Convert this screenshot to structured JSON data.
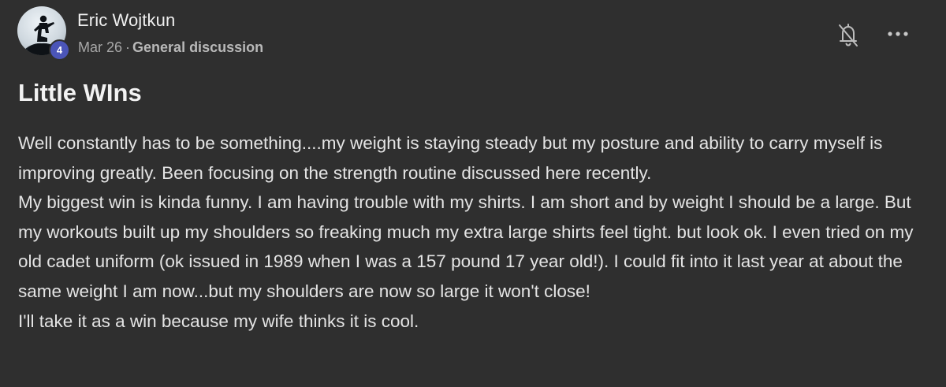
{
  "post": {
    "author": "Eric Wojtkun",
    "badge_count": "4",
    "date": "Mar 26",
    "separator": "·",
    "category": "General discussion",
    "title": "Little WIns",
    "paragraphs": [
      "Well constantly has to be something....my weight is staying steady but my posture and ability to carry myself is improving greatly. Been focusing on the strength routine discussed here recently.",
      "My biggest win is kinda funny. I am having trouble with my shirts. I am short and by weight I should be a large. But my workouts built up my shoulders so freaking much my extra large shirts feel tight. but look ok. I even tried on my old cadet uniform (ok issued in 1989 when I was a 157 pound 17 year old!). I could fit into it last year at about the same weight I am now...but my shoulders are now so large it won't close!",
      "I'll take it as a win because my wife thinks it is cool."
    ]
  },
  "icons": {
    "avatar": "avatar-silhouette-icon",
    "notification": "bell-off-icon",
    "menu": "more-horizontal-icon"
  },
  "colors": {
    "background": "#2f2f2f",
    "badge": "#4b55b8",
    "text": "#e4e4e4",
    "muted": "#a8a8a8"
  }
}
